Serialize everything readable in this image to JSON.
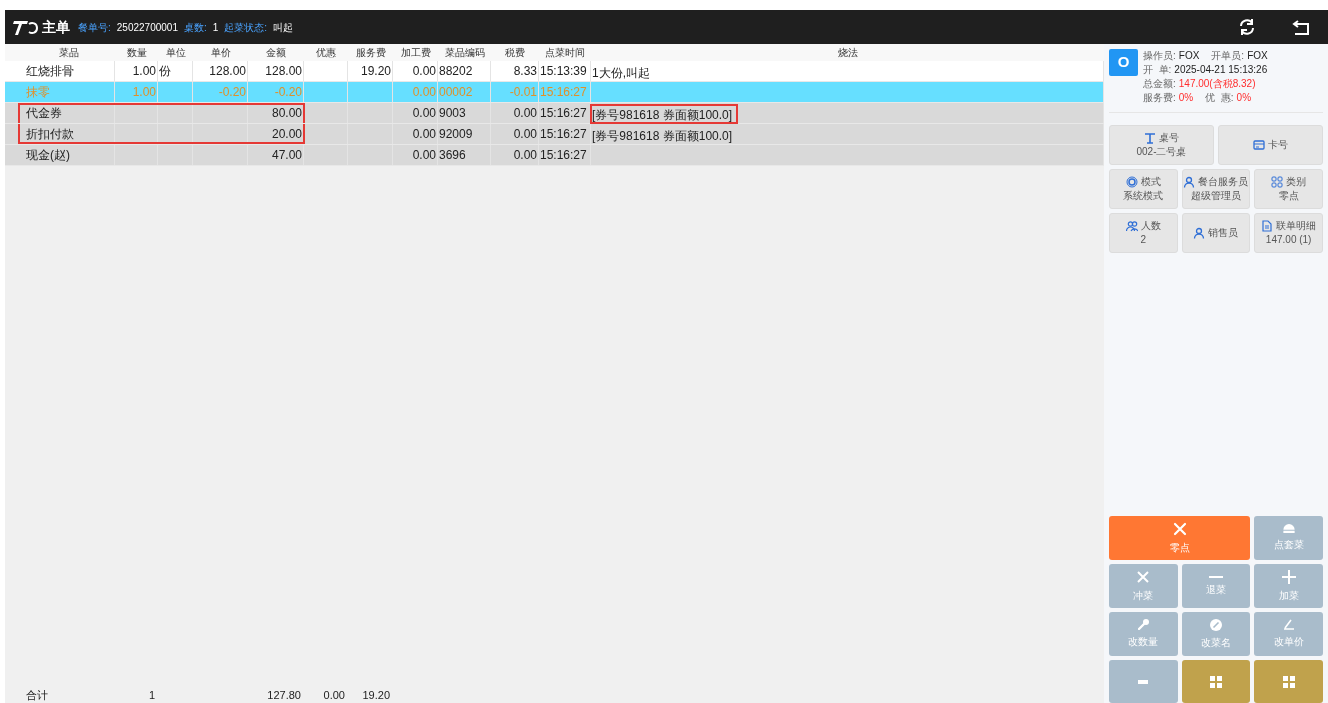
{
  "header": {
    "title": "主单",
    "fields": [
      {
        "label": "餐单号:",
        "value": "25022700001"
      },
      {
        "label": "桌数:",
        "value": "1"
      },
      {
        "label": "起菜状态:",
        "value": "叫起"
      }
    ]
  },
  "table": {
    "columns": [
      "菜品",
      "数量",
      "单位",
      "单价",
      "金额",
      "优惠",
      "服务费",
      "加工费",
      "菜品编码",
      "税费",
      "点菜时间",
      "烧法"
    ],
    "rows": [
      {
        "kind": "item",
        "selected": false,
        "marked": false,
        "note_marked": false,
        "cells": [
          "红烧排骨",
          "1.00",
          "份",
          "128.00",
          "128.00",
          null,
          "19.20",
          "0.00",
          "88202",
          "8.33",
          "15:13:39",
          "1大份,叫起"
        ]
      },
      {
        "kind": "adjust",
        "selected": true,
        "marked": false,
        "note_marked": false,
        "cells": [
          "抹零",
          "1.00",
          null,
          "-0.20",
          "-0.20",
          null,
          null,
          "0.00",
          "00002",
          "-0.01",
          "15:16:27",
          null
        ]
      },
      {
        "kind": "payment",
        "selected": false,
        "marked": true,
        "note_marked": true,
        "cells": [
          "代金券",
          null,
          null,
          null,
          "80.00",
          null,
          null,
          "0.00",
          "9003",
          "0.00",
          "15:16:27",
          "[券号981618 券面额100.0]"
        ]
      },
      {
        "kind": "payment",
        "selected": false,
        "marked": true,
        "note_marked": false,
        "cells": [
          "折扣付款",
          null,
          null,
          null,
          "20.00",
          null,
          null,
          "0.00",
          "92009",
          "0.00",
          "15:16:27",
          "[券号981618 券面额100.0]"
        ]
      },
      {
        "kind": "payment",
        "selected": false,
        "marked": false,
        "note_marked": false,
        "cells": [
          "现金(赵)",
          null,
          null,
          null,
          "47.00",
          null,
          null,
          "0.00",
          "3696",
          "0.00",
          "15:16:27",
          null
        ]
      }
    ],
    "totals": {
      "label": "合计",
      "quantity": "1",
      "amount": "127.80",
      "discount": "0.00",
      "service_fee": "19.20"
    }
  },
  "info": {
    "avatar": "O",
    "lines": [
      [
        {
          "label": "操作员:",
          "value": "FOX",
          "alert": false
        },
        {
          "label": "开单员:",
          "value": "FOX",
          "alert": false
        }
      ],
      [
        {
          "label": "开  单:",
          "value": "2025-04-21 15:13:26",
          "alert": false
        }
      ],
      [
        {
          "label": "总金额:",
          "value": "147.00(含税8.32)",
          "alert": true
        }
      ],
      [
        {
          "label": "服务费:",
          "value": "0%",
          "alert": true
        },
        {
          "label": "优  惠:",
          "value": "0%",
          "alert": true
        }
      ]
    ]
  },
  "info_buttons": [
    [
      {
        "title": "桌号",
        "value": "002-二号桌"
      },
      {
        "title": "卡号"
      }
    ],
    [
      {
        "title": "模式",
        "value": "系统模式"
      },
      {
        "title": "餐台服务员",
        "value": "超级管理员"
      },
      {
        "title": "类别",
        "value": "零点"
      }
    ],
    [
      {
        "title": "人数",
        "value": "2"
      },
      {
        "title": "销售员"
      },
      {
        "title": "联单明细",
        "value": "147.00 (1)"
      }
    ]
  ],
  "action_buttons": [
    {
      "label": "零点",
      "kind": "primary",
      "wide": true
    },
    {
      "label": "点套菜",
      "kind": "normal",
      "wide": false
    },
    {
      "label": "冲菜",
      "kind": "normal",
      "wide": false
    },
    {
      "label": "退菜",
      "kind": "normal",
      "wide": false
    },
    {
      "label": "加菜",
      "kind": "normal",
      "wide": false
    },
    {
      "label": "改数量",
      "kind": "normal",
      "wide": false
    },
    {
      "label": "改菜名",
      "kind": "normal",
      "wide": false
    },
    {
      "label": "改单价",
      "kind": "normal",
      "wide": false
    },
    {
      "kind": "normal",
      "wide": false
    },
    {
      "kind": "gold",
      "wide": false
    },
    {
      "kind": "gold",
      "wide": false
    }
  ]
}
